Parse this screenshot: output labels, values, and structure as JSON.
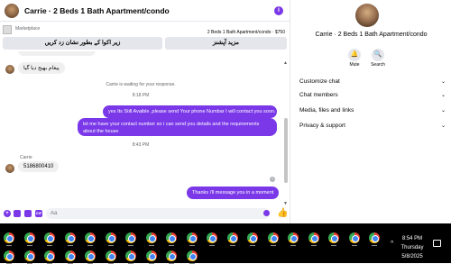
{
  "chat": {
    "title": "Carrie · 2 Beds 1 Bath Apartment/condo",
    "info_glyph": "i",
    "listing": {
      "source": "Marketplace",
      "description": "2 Beds 1 Bath Apartment/condo · $750"
    },
    "buttons": {
      "save": "زیر اکوا کے بطور نشان زد کریں",
      "more": "مزید آپشنز"
    },
    "messages": {
      "incoming_1": "پیغام بھیج دیا گیا",
      "waiting_notice": "Carrie is waiting for your response.",
      "time_1": "8:18 PM",
      "outgoing_1": "yes Its Still Avaible ,please send Your phone Numbar I will contact you soon.",
      "outgoing_2": "let me have your contact number so i can send you details and the requirements about the house",
      "time_2": "8:43 PM",
      "sender_name": "Carrie",
      "incoming_2": "5186800410",
      "outgoing_3": "Thanks i'll message you in a moment",
      "seen_glyph": "?"
    },
    "composer": {
      "placeholder": "Aa"
    }
  },
  "details": {
    "title": "Carrie · 2 Beds 1 Bath Apartment/condo",
    "mute_label": "Mute",
    "search_label": "Search",
    "menu": [
      {
        "label": "Customize chat"
      },
      {
        "label": "Chat members"
      },
      {
        "label": "Media, files and links"
      },
      {
        "label": "Privacy & support"
      }
    ]
  },
  "taskbar": {
    "time": "8:54 PM",
    "day": "Thursday",
    "date": "5/8/2025",
    "icon_name": "chrome-icon"
  },
  "colors": {
    "accent": "#7a38e8",
    "incoming_bubble": "#f0f0f0",
    "taskbar": "#000000"
  }
}
